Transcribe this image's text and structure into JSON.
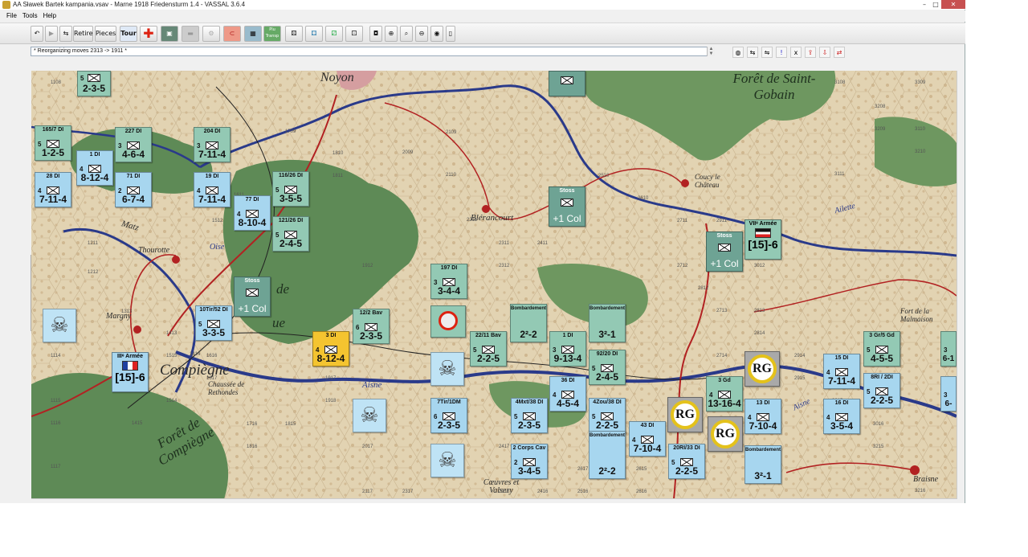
{
  "window": {
    "title": "AA Sławek Bartek kampania.vsav - Marne 1918 Friedensturm 1.4 - VASSAL 3.6.4",
    "controls": [
      "–",
      "□",
      "✕"
    ]
  },
  "menu": [
    "File",
    "Tools",
    "Help"
  ],
  "toolbar": {
    "retire_label": "Retire",
    "pieces_label": "Pieces",
    "tour_label": "Tour",
    "plus_label": "Plu\nTransp",
    "icons": [
      "undo-icon",
      "step-icon",
      "retire-icon",
      "red-cross-icon",
      "tank-icon",
      "die-icon",
      "dice-icon",
      "camera-icon",
      "zoom-in-icon",
      "zoom-out-icon",
      "zoom-fit-icon",
      "globe-icon",
      "phone-icon"
    ]
  },
  "chat": {
    "text": "* Reorganizing moves 2313 -> 1911 *"
  },
  "map": {
    "labels": {
      "noyon": "Noyon",
      "foret_saint_gobain": "Forêt de Saint-Gobain",
      "coucy": "Coucy le Château",
      "blerancourt": "Blérancourt",
      "ailette": "Ailette",
      "matz": "Matz",
      "thourotte": "Thourotte",
      "oise": "Oise",
      "margny": "Margny",
      "compiegne": "Compiègne",
      "chaussee": "Chaussée de Rethondes",
      "aisne": "Aisne",
      "aisne2": "Aisne",
      "foret_compiegne": "Forêt de Compiègne",
      "coeuvres": "Cœuvres et Valsery",
      "fort_malmaison": "Fort de la Malmaison",
      "braisne": "Braisne",
      "de": "de",
      "ue": "ue"
    },
    "hex_numbers": [
      "1108",
      "1109",
      "1211",
      "1212",
      "1313",
      "1413",
      "1414",
      "1114",
      "1115",
      "1116",
      "1117",
      "1512",
      "1611",
      "1709",
      "1810",
      "1811",
      "1912",
      "2009",
      "2109",
      "2110",
      "2211",
      "2311",
      "2312",
      "2411",
      "2510",
      "2610",
      "2711",
      "2712",
      "2812",
      "2911",
      "3012",
      "3108",
      "3208",
      "3209",
      "3309",
      "3110",
      "3111",
      "3210",
      "2713",
      "2714",
      "2813",
      "2814",
      "2914",
      "2915",
      "3015",
      "3016",
      "3215",
      "3216",
      "3317",
      "2615",
      "2616",
      "2617",
      "2516",
      "2517",
      "2416",
      "2417",
      "2316",
      "2317",
      "2117",
      "2017",
      "1917",
      "1918",
      "1815",
      "1816",
      "1716",
      "1617",
      "1616",
      "1515",
      "1514",
      "1415",
      "1416",
      "1316"
    ],
    "armies": [
      {
        "id": "third",
        "name": "IIIᵉ Armée",
        "strength": "[15]-6",
        "flag": "fr"
      },
      {
        "id": "seventh",
        "name": "VIIᵉ Armée",
        "strength": "[15]-6",
        "flag": "de"
      }
    ],
    "counters": [
      {
        "id": "c1",
        "hd": "",
        "size": "5",
        "stats": "2-3-5",
        "color": "gr"
      },
      {
        "id": "c2",
        "hd": "165/7 DI",
        "size": "5",
        "stats": "1-2-5",
        "color": "gr"
      },
      {
        "id": "c3",
        "hd": "227 DI",
        "size": "3",
        "stats": "4-6-4",
        "color": "gr"
      },
      {
        "id": "c4",
        "hd": "204 DI",
        "size": "3",
        "stats": "7-11-4",
        "color": "gr"
      },
      {
        "id": "c5",
        "hd": "1 DI",
        "size": "4",
        "stats": "8-12-4",
        "color": "fr"
      },
      {
        "id": "c6",
        "hd": "28 DI",
        "size": "4",
        "stats": "7-11-4",
        "color": "fr"
      },
      {
        "id": "c7",
        "hd": "71 DI",
        "size": "2",
        "stats": "6-7-4",
        "color": "fr"
      },
      {
        "id": "c8",
        "hd": "19 DI",
        "size": "4",
        "stats": "7-11-4",
        "color": "fr"
      },
      {
        "id": "c9",
        "hd": "77 DI",
        "size": "4",
        "stats": "8-10-4",
        "color": "fr"
      },
      {
        "id": "c10",
        "hd": "116/26 DI",
        "size": "5",
        "stats": "3-5-5",
        "color": "gr"
      },
      {
        "id": "c11",
        "hd": "121/26 DI",
        "size": "5",
        "stats": "2-4-5",
        "color": "gr"
      },
      {
        "id": "c12",
        "hd": "10Tir/52 DI",
        "size": "5",
        "stats": "3-3-5",
        "color": "fr"
      },
      {
        "id": "c13",
        "hd": "12/2 Bav",
        "size": "6",
        "stats": "2-3-5",
        "color": "gr"
      },
      {
        "id": "c14",
        "hd": "3 DI",
        "size": "4",
        "stats": "8-12-4",
        "color": "ye"
      },
      {
        "id": "c15",
        "hd": "197 DI",
        "size": "3",
        "stats": "3-4-4",
        "color": "gr"
      },
      {
        "id": "c16",
        "hd": "22/11 Bav",
        "size": "5",
        "stats": "2-2-5",
        "color": "gr"
      },
      {
        "id": "c17",
        "hd": "1 DI",
        "size": "3",
        "stats": "9-13-4",
        "color": "gr"
      },
      {
        "id": "c18",
        "hd": "92/20 DI",
        "size": "5",
        "stats": "2-4-5",
        "color": "gr"
      },
      {
        "id": "c19",
        "hd": "36 DI",
        "size": "4",
        "stats": "4-5-4",
        "color": "fr"
      },
      {
        "id": "c20",
        "hd": "7Tir/1DM",
        "size": "6",
        "stats": "2-3-5",
        "color": "fr"
      },
      {
        "id": "c21",
        "hd": "4Mxt/38 DI",
        "size": "5",
        "stats": "2-3-5",
        "color": "fr"
      },
      {
        "id": "c22",
        "hd": "4Zou/38 DI",
        "size": "5",
        "stats": "2-2-5",
        "color": "fr"
      },
      {
        "id": "c23",
        "hd": "43 DI",
        "size": "4",
        "stats": "7-10-4",
        "color": "fr"
      },
      {
        "id": "c24",
        "hd": "2 Corps Cav",
        "size": "2",
        "stats": "3-4-5",
        "color": "fr"
      },
      {
        "id": "c25",
        "hd": "20RI/33 DI",
        "size": "5",
        "stats": "2-2-5",
        "color": "fr"
      },
      {
        "id": "c26",
        "hd": "3 Gd",
        "size": "4",
        "stats": "13-16-4",
        "color": "gr"
      },
      {
        "id": "c27",
        "hd": "13 DI",
        "size": "4",
        "stats": "7-10-4",
        "color": "fr"
      },
      {
        "id": "c28",
        "hd": "15 DI",
        "size": "4",
        "stats": "7-11-4",
        "color": "fr"
      },
      {
        "id": "c29",
        "hd": "3 Gr/5 Gd",
        "size": "5",
        "stats": "4-5-5",
        "color": "gr"
      },
      {
        "id": "c30",
        "hd": "8RI / 2DI",
        "size": "5",
        "stats": "2-2-5",
        "color": "fr"
      },
      {
        "id": "c31",
        "hd": "16 DI",
        "size": "4",
        "stats": "3-5-4",
        "color": "fr"
      },
      {
        "id": "c32",
        "hd": "",
        "size": "3",
        "stats": "6-1",
        "color": "gr"
      },
      {
        "id": "c33",
        "hd": "",
        "size": "3",
        "stats": "6-",
        "color": "fr"
      }
    ],
    "stoss": [
      {
        "id": "s1",
        "hd": "Stoss",
        "stats": "+1 Col"
      },
      {
        "id": "s2",
        "hd": "Stoss",
        "stats": "+1 Col"
      },
      {
        "id": "s3",
        "hd": "Stoss",
        "stats": "+1 Col"
      }
    ],
    "bombardement": [
      {
        "id": "b1",
        "hd": "Bombardement",
        "stats": "2²-2",
        "color": "gr"
      },
      {
        "id": "b2",
        "hd": "Bombardement",
        "stats": "3²-1",
        "color": "gr"
      },
      {
        "id": "b3",
        "hd": "Bombardement",
        "stats": "2²-2",
        "color": "fr"
      },
      {
        "id": "b4",
        "hd": "Bombardement",
        "stats": "3²-1",
        "color": "fr"
      }
    ],
    "rg_label": "RG",
    "skull_glyph": "☠"
  }
}
